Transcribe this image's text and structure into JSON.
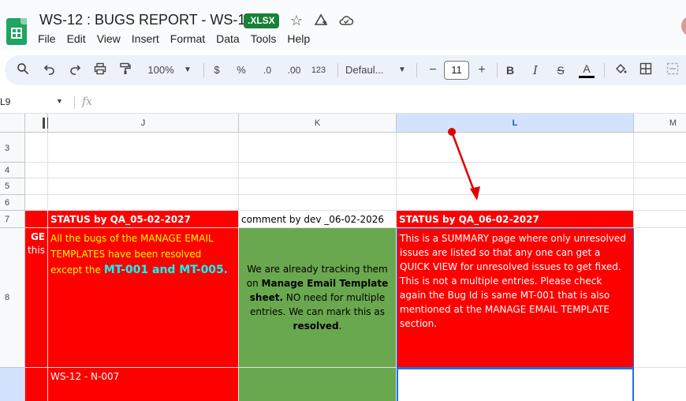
{
  "window": {
    "title": "WS-12 : BUGS REPORT - WS-12",
    "badge": ".XLSX"
  },
  "menu": [
    "File",
    "Edit",
    "View",
    "Insert",
    "Format",
    "Data",
    "Tools",
    "Help"
  ],
  "toolbar": {
    "zoom": "100%",
    "currency": "$",
    "percent": "%",
    "dec_decrease": ".0",
    "dec_increase": ".00",
    "number_format": "123",
    "font": "Defaul...",
    "font_size": "11",
    "bold": "B",
    "italic": "I",
    "strike": "S",
    "text_color": "A"
  },
  "formula_bar": {
    "name_box": "L9",
    "fx": "fx"
  },
  "columns": [
    "J",
    "K",
    "L",
    "M"
  ],
  "rows": [
    "3",
    "4",
    "5",
    "6",
    "7",
    "8"
  ],
  "cells": {
    "j7": "STATUS by QA_05-02-2027",
    "k7": "comment by dev _06-02-2026",
    "l7": "STATUS by QA_06-02-2027",
    "i8_line1": "GE",
    "i8_line2": "this",
    "j8_part1": "All the bugs of the MANAGE EMAIL TEMPLATES  have been resolved except the ",
    "j8_part2": "MT-001 and MT-005.",
    "k8_part1": "We are already tracking them on ",
    "k8_part2": "Manage Email Template sheet.",
    "k8_part3": " NO need for multiple entries. We can mark this as ",
    "k8_part4": "resolved",
    "k8_part5": ".",
    "l8": "This is a SUMMARY page where only unresolved issues are listed so that any one can get a QUICK VIEW for unresolved issues to get fixed.  This is not a multiple entries. Please check again the Bug Id is same MT-001 that is also mentioned at the MANAGE EMAIL TEMPLATE section.",
    "j9": "WS-12 - N-007"
  },
  "colors": {
    "red_fill": "#ff0000",
    "green_fill": "#6aa84f",
    "selection": "#1a73e8",
    "arrow": "#e00000"
  },
  "icons": [
    "sheets-logo-icon",
    "star-icon",
    "move-to-drive-icon",
    "cloud-status-icon",
    "search-icon",
    "undo-icon",
    "redo-icon",
    "print-icon",
    "paint-format-icon",
    "fill-color-icon",
    "borders-icon",
    "merge-cells-icon"
  ]
}
